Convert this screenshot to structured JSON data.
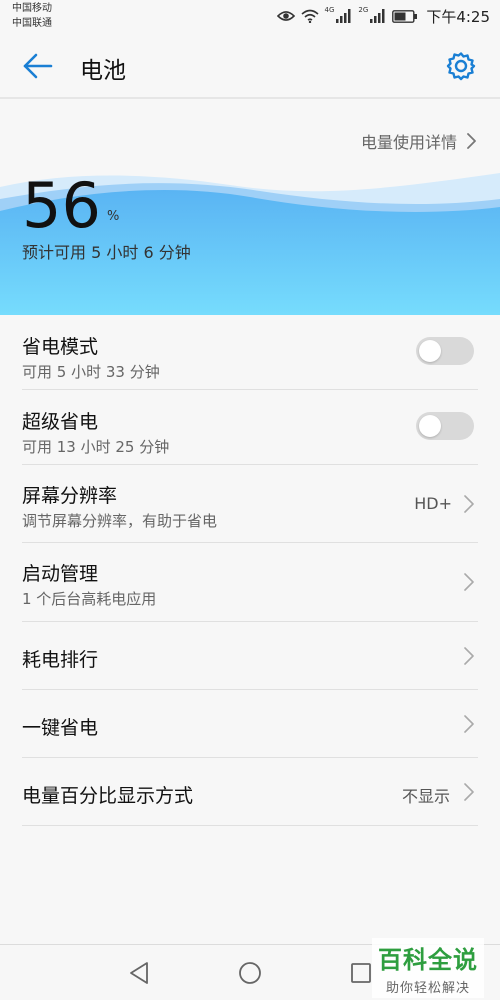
{
  "status_bar": {
    "carrier_1": "中国移动",
    "carrier_2": "中国联通",
    "net_1": "4G",
    "net_2": "2G",
    "time": "下午4:25",
    "icons": [
      "eye-icon",
      "wifi-icon",
      "signal-icon",
      "signal-icon",
      "battery-icon"
    ]
  },
  "app_bar": {
    "title": "电池",
    "back_icon": "arrow-left-icon",
    "settings_icon": "gear-icon",
    "accent_color": "#1a7fd4"
  },
  "battery": {
    "usage_link": "电量使用详情",
    "percent": "56",
    "percent_sign": "%",
    "level": 0.56,
    "remaining": "预计可用 5 小时 6 分钟",
    "wave_colors": [
      "#58b6f5",
      "#7ad3fb",
      "#cfe8fb"
    ]
  },
  "settings": {
    "power_saving": {
      "title": "省电模式",
      "subtitle": "可用 5 小时 33 分钟",
      "enabled": false
    },
    "ultra_power_saving": {
      "title": "超级省电",
      "subtitle": "可用 13 小时 25 分钟",
      "enabled": false
    },
    "screen_resolution": {
      "title": "屏幕分辨率",
      "subtitle": "调节屏幕分辨率，有助于省电",
      "value": "HD+"
    },
    "startup_management": {
      "title": "启动管理",
      "subtitle": "1 个后台高耗电应用"
    },
    "power_ranking": {
      "title": "耗电排行"
    },
    "one_tap_saving": {
      "title": "一键省电"
    },
    "percentage_display": {
      "title": "电量百分比显示方式",
      "value": "不显示"
    }
  },
  "nav_bar": {
    "icons": [
      "triangle-back-icon",
      "circle-home-icon",
      "square-recent-icon"
    ]
  },
  "watermark": {
    "main": "百科全说",
    "sub": "助你轻松解决"
  }
}
